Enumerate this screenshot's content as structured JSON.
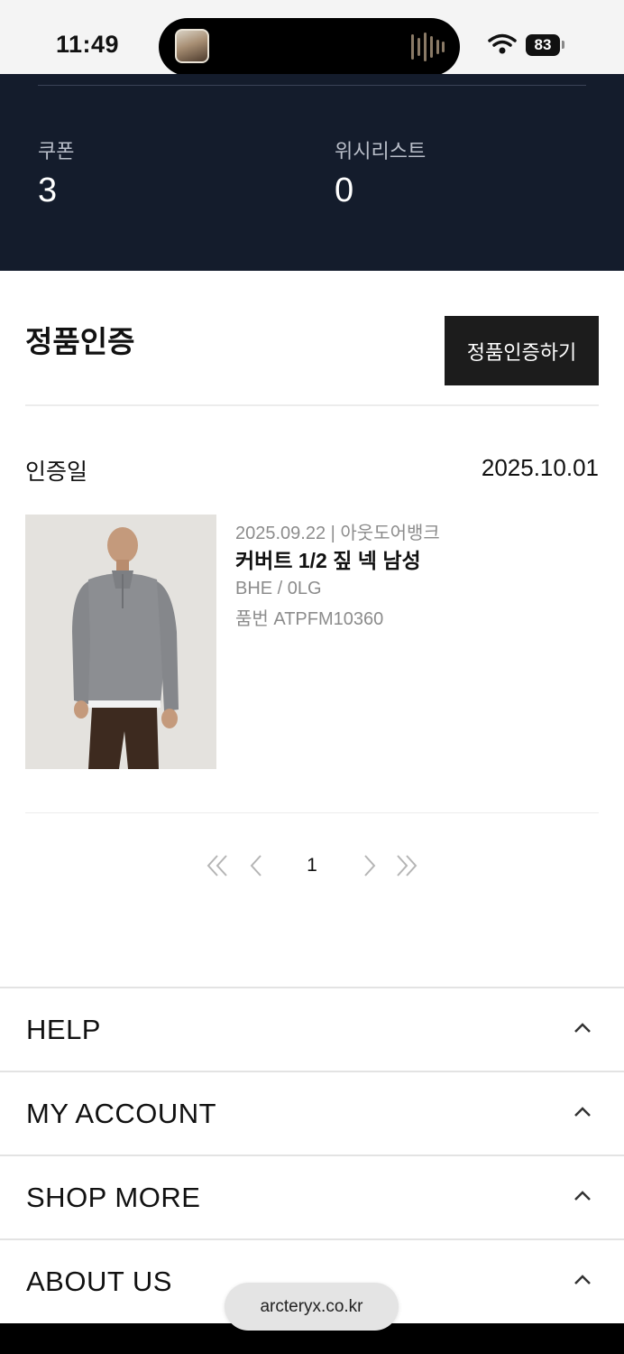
{
  "status_bar": {
    "time": "11:49",
    "battery": "83",
    "icons": [
      "wifi-icon",
      "battery-icon",
      "audio-wave-icon"
    ]
  },
  "summary": {
    "coupon_label": "쿠폰",
    "coupon_value": "3",
    "wishlist_label": "위시리스트",
    "wishlist_value": "0",
    "background": "#141c2c"
  },
  "authenticity": {
    "title": "정품인증",
    "button_label": "정품인증하기",
    "cert_label": "인증일",
    "cert_date": "2025.10.01"
  },
  "product": {
    "meta": "2025.09.22 | 아웃도어뱅크",
    "name": "커버트 1/2 짚 넥 남성",
    "option": "BHE / 0LG",
    "code": "품번 ATPFM10360"
  },
  "pagination": {
    "current": "1",
    "icons": [
      "double-chevron-left-icon",
      "chevron-left-icon",
      "chevron-right-icon",
      "double-chevron-right-icon"
    ]
  },
  "footer": {
    "sections": [
      {
        "label": "HELP"
      },
      {
        "label": "MY ACCOUNT"
      },
      {
        "label": "SHOP MORE"
      },
      {
        "label": "ABOUT US"
      }
    ]
  },
  "browser": {
    "url": "arcteryx.co.kr"
  }
}
